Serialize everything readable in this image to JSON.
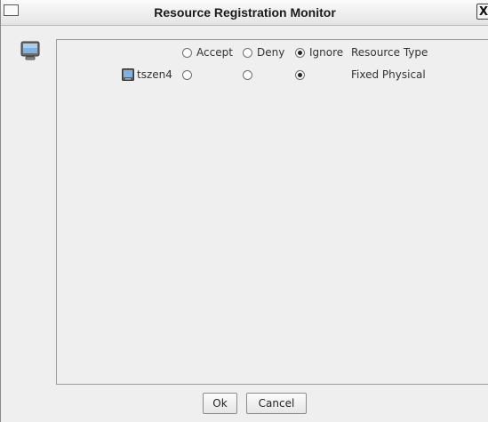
{
  "window": {
    "title": "Resource Registration Monitor",
    "close_glyph": "X",
    "menu_icon": "window-menu-icon",
    "side_icon": "monitor-icon"
  },
  "table": {
    "headers": {
      "accept": "Accept",
      "deny": "Deny",
      "ignore": "Ignore",
      "resource_type": "Resource Type"
    },
    "header_selected": "ignore",
    "rows": [
      {
        "icon": "monitor-icon",
        "name": "tszen4",
        "selected": "ignore",
        "resource_type": "Fixed Physical"
      }
    ]
  },
  "buttons": {
    "ok": "Ok",
    "cancel": "Cancel"
  }
}
